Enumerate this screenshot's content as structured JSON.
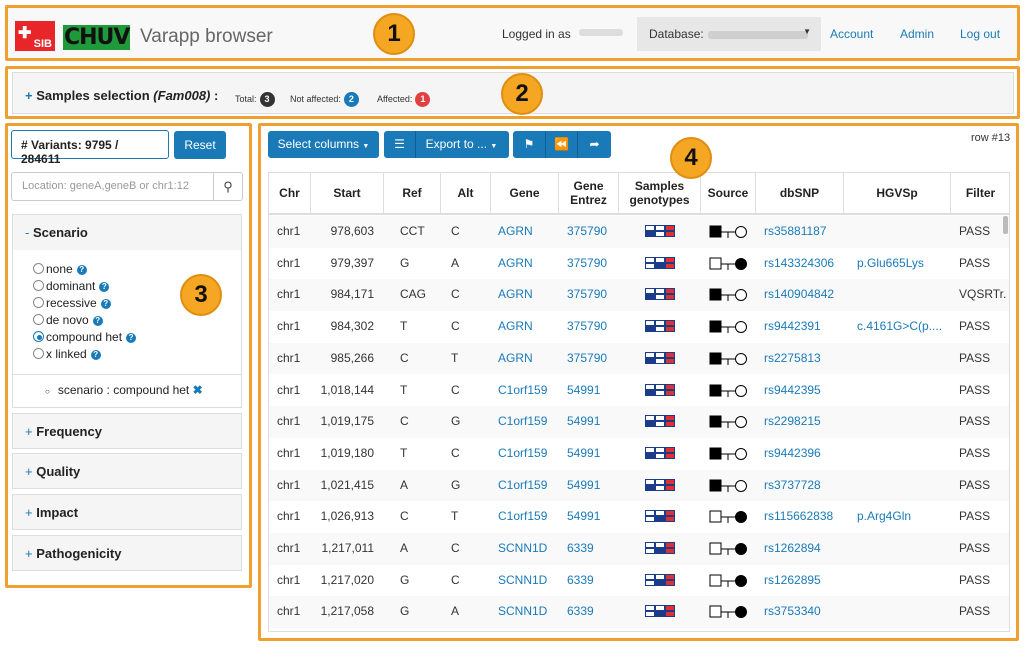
{
  "header": {
    "sib_logo": "SIB",
    "chuv_logo": "CHUV",
    "title": "Varapp browser",
    "logged_in": "Logged in as",
    "database_label": "Database:",
    "account": "Account",
    "admin": "Admin",
    "logout": "Log out"
  },
  "samples": {
    "title_prefix": "Samples selection",
    "family": "(Fam008)",
    "suffix": ":",
    "total_label": "Total:",
    "total": "3",
    "not_affected_label": "Not affected:",
    "not_affected": "2",
    "affected_label": "Affected:",
    "affected": "1"
  },
  "left": {
    "variants": "# Variants: 9795 / 284611",
    "reset": "Reset",
    "location_placeholder": "Location: geneA,geneB or chr1:12",
    "scenario_title": "Scenario",
    "scenarios": [
      "none",
      "dominant",
      "recessive",
      "de novo",
      "compound het",
      "x linked"
    ],
    "selected_scenario": "compound het",
    "filter_tag": "scenario : compound het",
    "panels": [
      "Frequency",
      "Quality",
      "Impact",
      "Pathogenicity"
    ]
  },
  "toolbar": {
    "select_columns": "Select columns",
    "export": "Export to ...",
    "row_label": "row #13"
  },
  "table": {
    "headers": [
      "Chr",
      "Start",
      "Ref",
      "Alt",
      "Gene",
      "Gene Entrez",
      "Samples genotypes",
      "Source",
      "dbSNP",
      "HGVSp",
      "Filter"
    ],
    "rows": [
      {
        "chr": "chr1",
        "start": "978,603",
        "ref": "CCT",
        "alt": "C",
        "gene": "AGRN",
        "entrez": "375790",
        "gt": [
          1,
          0,
          2
        ],
        "src": "maternal",
        "dbsnp": "rs35881187",
        "hgvsp": "",
        "filter": "PASS"
      },
      {
        "chr": "chr1",
        "start": "979,397",
        "ref": "G",
        "alt": "A",
        "gene": "AGRN",
        "entrez": "375790",
        "gt": [
          0,
          1,
          2
        ],
        "src": "paternal",
        "dbsnp": "rs143324306",
        "hgvsp": "p.Glu665Lys",
        "filter": "PASS"
      },
      {
        "chr": "chr1",
        "start": "984,171",
        "ref": "CAG",
        "alt": "C",
        "gene": "AGRN",
        "entrez": "375790",
        "gt": [
          1,
          0,
          2
        ],
        "src": "maternal",
        "dbsnp": "rs140904842",
        "hgvsp": "",
        "filter": "VQSRTr."
      },
      {
        "chr": "chr1",
        "start": "984,302",
        "ref": "T",
        "alt": "C",
        "gene": "AGRN",
        "entrez": "375790",
        "gt": [
          1,
          0,
          2
        ],
        "src": "maternal",
        "dbsnp": "rs9442391",
        "hgvsp": "c.4161G>C(p....",
        "filter": "PASS"
      },
      {
        "chr": "chr1",
        "start": "985,266",
        "ref": "C",
        "alt": "T",
        "gene": "AGRN",
        "entrez": "375790",
        "gt": [
          1,
          0,
          2
        ],
        "src": "maternal",
        "dbsnp": "rs2275813",
        "hgvsp": "",
        "filter": "PASS"
      },
      {
        "chr": "chr1",
        "start": "1,018,144",
        "ref": "T",
        "alt": "C",
        "gene": "C1orf159",
        "entrez": "54991",
        "gt": [
          1,
          0,
          2
        ],
        "src": "maternal",
        "dbsnp": "rs9442395",
        "hgvsp": "",
        "filter": "PASS"
      },
      {
        "chr": "chr1",
        "start": "1,019,175",
        "ref": "C",
        "alt": "G",
        "gene": "C1orf159",
        "entrez": "54991",
        "gt": [
          1,
          0,
          2
        ],
        "src": "maternal",
        "dbsnp": "rs2298215",
        "hgvsp": "",
        "filter": "PASS"
      },
      {
        "chr": "chr1",
        "start": "1,019,180",
        "ref": "T",
        "alt": "C",
        "gene": "C1orf159",
        "entrez": "54991",
        "gt": [
          1,
          0,
          2
        ],
        "src": "maternal",
        "dbsnp": "rs9442396",
        "hgvsp": "",
        "filter": "PASS"
      },
      {
        "chr": "chr1",
        "start": "1,021,415",
        "ref": "A",
        "alt": "G",
        "gene": "C1orf159",
        "entrez": "54991",
        "gt": [
          1,
          0,
          2
        ],
        "src": "maternal",
        "dbsnp": "rs3737728",
        "hgvsp": "",
        "filter": "PASS"
      },
      {
        "chr": "chr1",
        "start": "1,026,913",
        "ref": "C",
        "alt": "T",
        "gene": "C1orf159",
        "entrez": "54991",
        "gt": [
          0,
          1,
          2
        ],
        "src": "paternal",
        "dbsnp": "rs115662838",
        "hgvsp": "p.Arg4Gln",
        "filter": "PASS"
      },
      {
        "chr": "chr1",
        "start": "1,217,011",
        "ref": "A",
        "alt": "C",
        "gene": "SCNN1D",
        "entrez": "6339",
        "gt": [
          0,
          1,
          2
        ],
        "src": "paternal",
        "dbsnp": "rs1262894",
        "hgvsp": "",
        "filter": "PASS"
      },
      {
        "chr": "chr1",
        "start": "1,217,020",
        "ref": "G",
        "alt": "C",
        "gene": "SCNN1D",
        "entrez": "6339",
        "gt": [
          0,
          1,
          2
        ],
        "src": "paternal",
        "dbsnp": "rs1262895",
        "hgvsp": "",
        "filter": "PASS"
      },
      {
        "chr": "chr1",
        "start": "1,217,058",
        "ref": "G",
        "alt": "A",
        "gene": "SCNN1D",
        "entrez": "6339",
        "gt": [
          0,
          1,
          2
        ],
        "src": "paternal",
        "dbsnp": "rs3753340",
        "hgvsp": "",
        "filter": "PASS"
      }
    ]
  },
  "callouts": [
    "1",
    "2",
    "3",
    "4"
  ],
  "colors": {
    "accent": "#1a7ab8",
    "callout": "#f5a623",
    "het": "#e03030",
    "hom": "#1a3c8a"
  }
}
